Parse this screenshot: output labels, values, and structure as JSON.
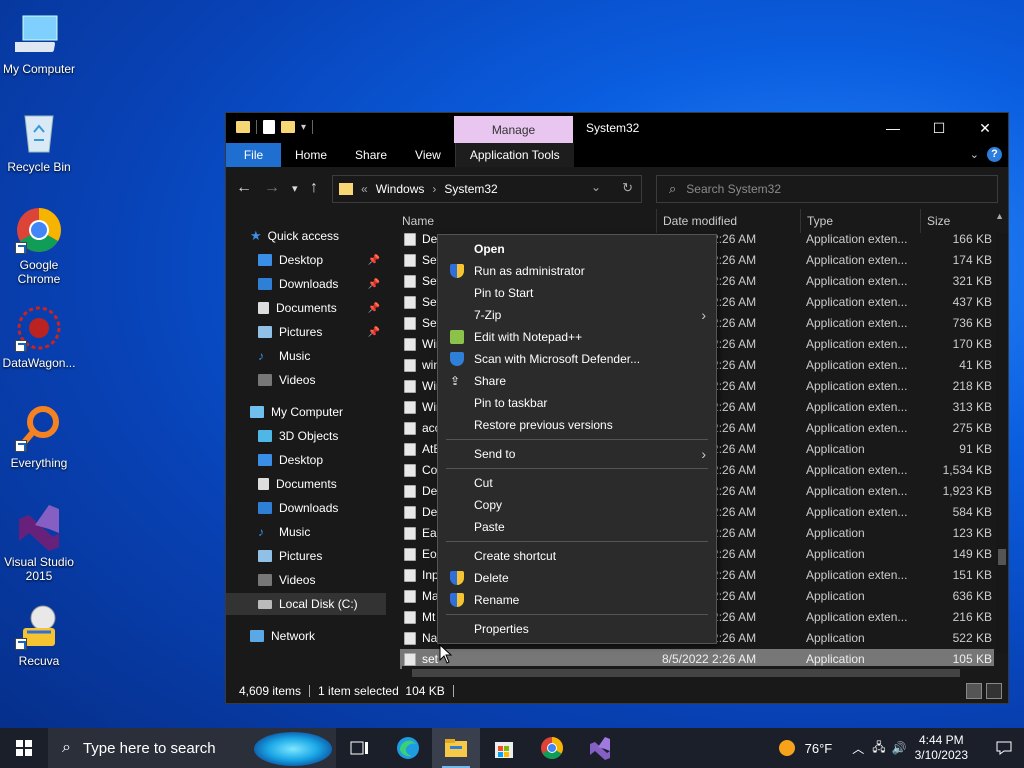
{
  "desktop": {
    "icons": [
      {
        "label": "My Computer",
        "icon": "my-computer-icon"
      },
      {
        "label": "Recycle Bin",
        "icon": "recycle-bin-icon"
      },
      {
        "label": "Google Chrome",
        "icon": "chrome-icon"
      },
      {
        "label": "DataWagon...",
        "icon": "datawagon-icon"
      },
      {
        "label": "Everything",
        "icon": "everything-icon"
      },
      {
        "label": "Visual Studio 2015",
        "icon": "visual-studio-icon"
      },
      {
        "label": "Recuva",
        "icon": "recuva-icon"
      }
    ]
  },
  "window": {
    "title": "System32",
    "manage_tab": "Manage",
    "controls": {
      "minimize": "—",
      "maximize": "☐",
      "close": "✕"
    },
    "ribbon": {
      "file": "File",
      "home": "Home",
      "share": "Share",
      "view": "View",
      "app_tools": "Application Tools"
    },
    "address": {
      "prefix": "«",
      "crumb1": "Windows",
      "sep": "›",
      "crumb2": "System32"
    },
    "search": {
      "placeholder": "Search System32"
    },
    "sidebar": {
      "quick_access": "Quick access",
      "qa_items": [
        "Desktop",
        "Downloads",
        "Documents",
        "Pictures",
        "Music",
        "Videos"
      ],
      "my_computer": "My Computer",
      "pc_items": [
        "3D Objects",
        "Desktop",
        "Documents",
        "Downloads",
        "Music",
        "Pictures",
        "Videos",
        "Local Disk (C:)"
      ],
      "network": "Network"
    },
    "columns": {
      "name": "Name",
      "date": "Date modified",
      "type": "Type",
      "size": "Size"
    },
    "rows": [
      {
        "name": "De",
        "date": "8/5/2022 2:26 AM",
        "type": "Application exten...",
        "size": "166 KB"
      },
      {
        "name": "Set",
        "date": "8/5/2022 2:26 AM",
        "type": "Application exten...",
        "size": "174 KB"
      },
      {
        "name": "Set",
        "date": "8/5/2022 2:26 AM",
        "type": "Application exten...",
        "size": "321 KB"
      },
      {
        "name": "Set",
        "date": "8/5/2022 2:26 AM",
        "type": "Application exten...",
        "size": "437 KB"
      },
      {
        "name": "Set",
        "date": "8/5/2022 2:26 AM",
        "type": "Application exten...",
        "size": "736 KB"
      },
      {
        "name": "Wir",
        "date": "8/5/2022 2:26 AM",
        "type": "Application exten...",
        "size": "170 KB"
      },
      {
        "name": "win",
        "date": "8/5/2022 2:26 AM",
        "type": "Application exten...",
        "size": "41 KB"
      },
      {
        "name": "Wir",
        "date": "8/5/2022 2:26 AM",
        "type": "Application exten...",
        "size": "218 KB"
      },
      {
        "name": "Wir",
        "date": "8/5/2022 2:26 AM",
        "type": "Application exten...",
        "size": "313 KB"
      },
      {
        "name": "acc",
        "date": "8/5/2022 2:26 AM",
        "type": "Application exten...",
        "size": "275 KB"
      },
      {
        "name": "AtE",
        "date": "8/5/2022 2:26 AM",
        "type": "Application",
        "size": "91 KB"
      },
      {
        "name": "Co",
        "date": "8/5/2022 2:26 AM",
        "type": "Application exten...",
        "size": "1,534 KB"
      },
      {
        "name": "Dev",
        "date": "8/5/2022 2:26 AM",
        "type": "Application exten...",
        "size": "1,923 KB"
      },
      {
        "name": "Dev",
        "date": "8/5/2022 2:26 AM",
        "type": "Application exten...",
        "size": "584 KB"
      },
      {
        "name": "Eas",
        "date": "8/5/2022 2:26 AM",
        "type": "Application",
        "size": "123 KB"
      },
      {
        "name": "EoA",
        "date": "8/5/2022 2:26 AM",
        "type": "Application",
        "size": "149 KB"
      },
      {
        "name": "Inp",
        "date": "8/5/2022 2:26 AM",
        "type": "Application exten...",
        "size": "151 KB"
      },
      {
        "name": "Ma",
        "date": "8/5/2022 2:26 AM",
        "type": "Application",
        "size": "636 KB"
      },
      {
        "name": "Mt",
        "date": "8/5/2022 2:26 AM",
        "type": "Application exten...",
        "size": "216 KB"
      },
      {
        "name": "Na",
        "date": "8/5/2022 2:26 AM",
        "type": "Application",
        "size": "522 KB"
      },
      {
        "name": "set",
        "date": "8/5/2022 2:26 AM",
        "type": "Application",
        "size": "105 KB"
      }
    ],
    "status": {
      "count": "4,609 items",
      "selected": "1 item selected  104 KB"
    }
  },
  "context_menu": {
    "open": "Open",
    "run_admin": "Run as administrator",
    "pin_start": "Pin to Start",
    "zip": "7-Zip",
    "notepad": "Edit with Notepad++",
    "defender": "Scan with Microsoft Defender...",
    "share": "Share",
    "pin_taskbar": "Pin to taskbar",
    "restore": "Restore previous versions",
    "send_to": "Send to",
    "cut": "Cut",
    "copy": "Copy",
    "paste": "Paste",
    "create_shortcut": "Create shortcut",
    "delete": "Delete",
    "rename": "Rename",
    "properties": "Properties"
  },
  "taskbar": {
    "search_placeholder": "Type here to search",
    "weather": "76°F",
    "time": "4:44 PM",
    "date": "3/10/2023"
  },
  "colors": {
    "accent": "#1f6fd0",
    "manage": "#e9c6f0",
    "desktop": "#0a5ee0"
  }
}
